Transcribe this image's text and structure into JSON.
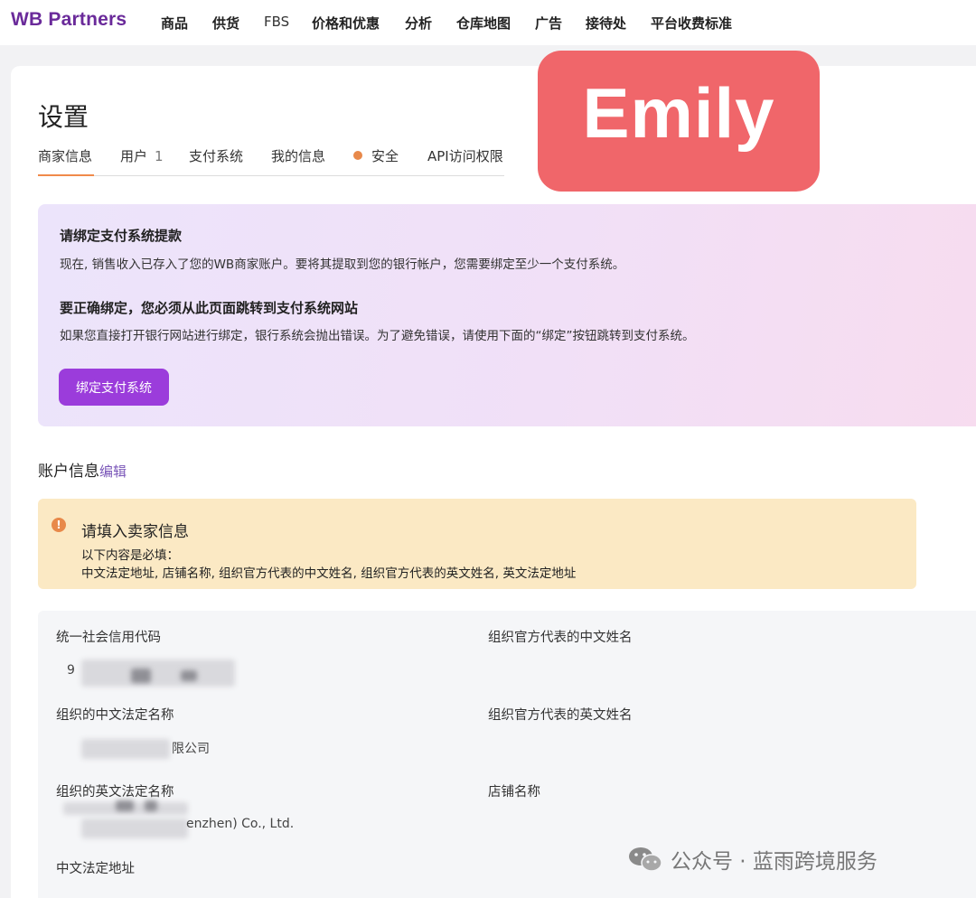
{
  "topnav": {
    "logo": "WB Partners",
    "items": [
      "商品",
      "供货",
      "FBS",
      "价格和优惠",
      "分析",
      "仓库地图",
      "广告",
      "接待处",
      "平台收费标准"
    ]
  },
  "settings": {
    "title": "设置",
    "tabs": {
      "merchant": "商家信息",
      "users": "用户",
      "users_count": "1",
      "payment": "支付系统",
      "my_info": "我的信息",
      "security": "安全",
      "api": "API访问权限"
    }
  },
  "promo": {
    "heading1": "请绑定支付系统提款",
    "text1": "现在, 销售收入已存入了您的WB商家账户。要将其提取到您的银行帐户，您需要绑定至少一个支付系统。",
    "heading2": "要正确绑定，您必须从此页面跳转到支付系统网站",
    "text2": "如果您直接打开银行网站进行绑定，银行系统会抛出错误。为了避免错误，请使用下面的“绑定”按钮跳转到支付系统。",
    "button": "绑定支付系统"
  },
  "account": {
    "title": "账户信息",
    "edit": "编辑"
  },
  "warning": {
    "icon": "!",
    "title": "请填入卖家信息",
    "line1": "以下内容是必填：",
    "line2": "中文法定地址, 店铺名称, 组织官方代表的中文姓名, 组织官方代表的英文姓名, 英文法定地址"
  },
  "fields": {
    "credit_code_label": "统一社会信用代码",
    "credit_code_value": "9",
    "rep_cn_label": "组织官方代表的中文姓名",
    "org_cn_label": "组织的中文法定名称",
    "org_cn_value": "限公司",
    "rep_en_label": "组织官方代表的英文姓名",
    "org_en_label": "组织的英文法定名称",
    "org_en_value": "enzhen) Co., Ltd.",
    "shop_label": "店铺名称",
    "address_cn_label": "中文法定地址"
  },
  "badge": {
    "text": "Emily"
  },
  "watermark": {
    "text": "公众号 · 蓝雨跨境服务"
  },
  "colors": {
    "brand": "#6a2a9a",
    "button": "#9b3cdb",
    "accent_orange": "#e8894a",
    "badge": "#f0666a",
    "warning_bg": "#fbe9c4"
  }
}
